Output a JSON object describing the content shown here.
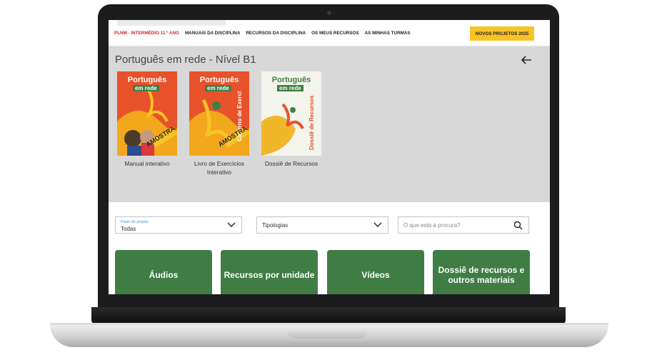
{
  "nav": {
    "items": [
      "PLNM - INTERMÉDIO 11.º ANO",
      "MANUAIS DA DISCIPLINA",
      "RECURSOS DA DISCIPLINA",
      "OS MEUS RECURSOS",
      "AS MINHAS TURMAS"
    ],
    "cta": "NOVOS PROJETOS 2025"
  },
  "panel": {
    "title": "Português em rede - Nível B1",
    "books": [
      {
        "title": "Manual interativo",
        "cover_top": "Português",
        "cover_bottom": "em rede",
        "stamp": "AMOSTRA"
      },
      {
        "title": "Livro de Exercícios Interativo",
        "cover_top": "Português",
        "cover_bottom": "em rede",
        "stamp": "AMOSTRA",
        "side": "Caderno de Exercícios"
      },
      {
        "title": "Dossiê de Recursos",
        "cover_top": "Português",
        "cover_bottom": "em rede",
        "side": "Dossiê de Recursos"
      }
    ]
  },
  "filters": {
    "part_label": "Parte do projeto",
    "part_value": "Todas",
    "typologies": "Tipologias",
    "search_placeholder": "O que está à procura?"
  },
  "tiles": [
    "Áudios",
    "Recursos por unidade",
    "Vídeos",
    "Dossiê de recursos e outros materiais"
  ],
  "colors": {
    "accent": "#f7c325",
    "tile": "#3f7d44",
    "brand": "#d92027"
  }
}
